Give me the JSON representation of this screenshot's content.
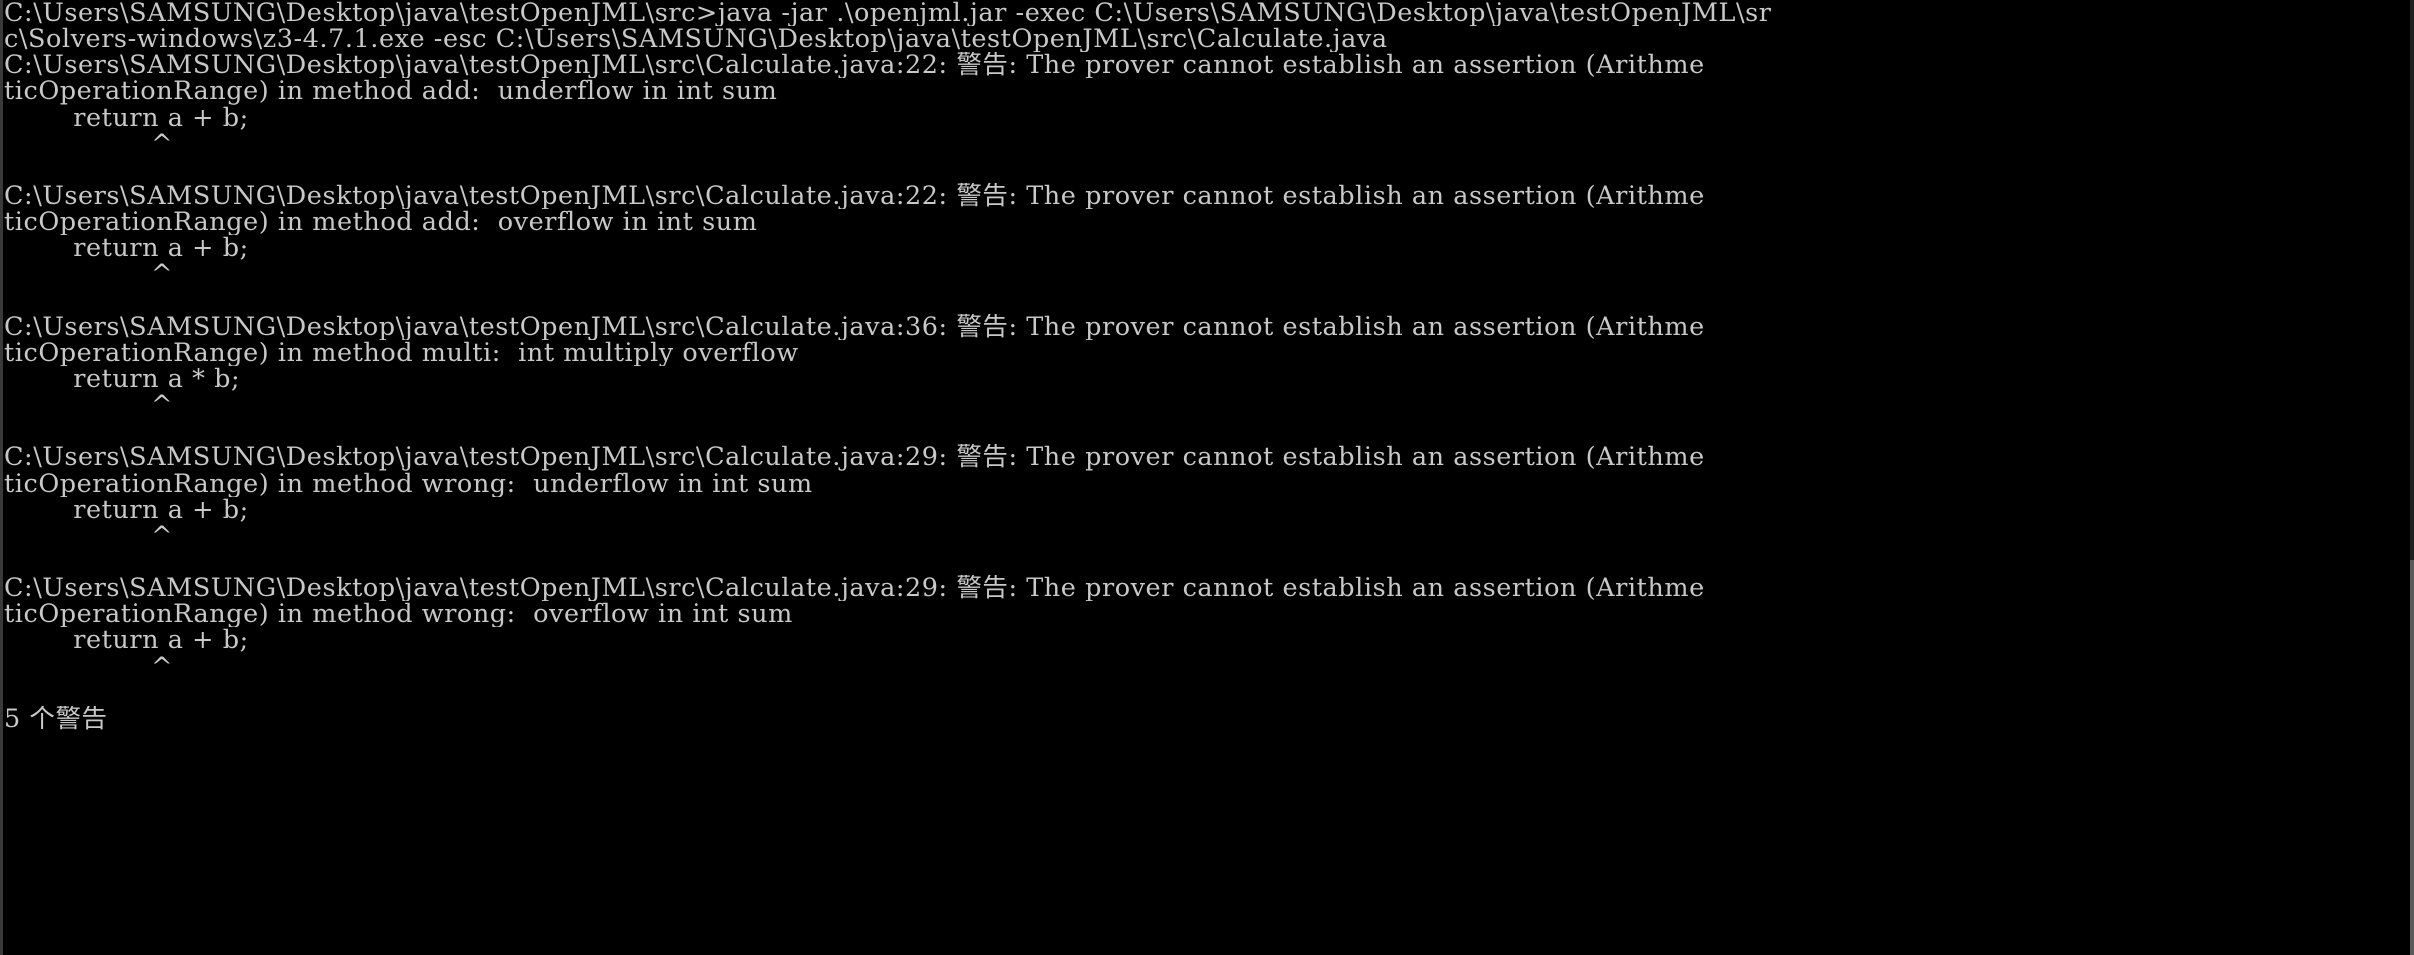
{
  "window": {
    "type": "windows-command-prompt",
    "background_color": "#000000",
    "foreground_color": "#c8c8c8",
    "font_size_px": 25
  },
  "prompt": {
    "path": "C:\\Users\\SAMSUNG\\Desktop\\java\\testOpenJML\\src",
    "symbol": ">",
    "command": "java -jar .\\openjml.jar -exec C:\\Users\\SAMSUNG\\Desktop\\java\\testOpenJML\\src\\Solvers-windows\\z3-4.7.1.exe -esc C:\\Users\\SAMSUNG\\Desktop\\java\\testOpenJML\\src\\Calculate.java"
  },
  "terminal": {
    "lines": [
      "C:\\Users\\SAMSUNG\\Desktop\\java\\testOpenJML\\src>java -jar .\\openjml.jar -exec C:\\Users\\SAMSUNG\\Desktop\\java\\testOpenJML\\sr",
      "c\\Solvers-windows\\z3-4.7.1.exe -esc C:\\Users\\SAMSUNG\\Desktop\\java\\testOpenJML\\src\\Calculate.java",
      "C:\\Users\\SAMSUNG\\Desktop\\java\\testOpenJML\\src\\Calculate.java:22: 警告: The prover cannot establish an assertion (Arithme",
      "ticOperationRange) in method add:  underflow in int sum",
      "        return a + b;",
      "                 ^",
      "",
      "C:\\Users\\SAMSUNG\\Desktop\\java\\testOpenJML\\src\\Calculate.java:22: 警告: The prover cannot establish an assertion (Arithme",
      "ticOperationRange) in method add:  overflow in int sum",
      "        return a + b;",
      "                 ^",
      "",
      "C:\\Users\\SAMSUNG\\Desktop\\java\\testOpenJML\\src\\Calculate.java:36: 警告: The prover cannot establish an assertion (Arithme",
      "ticOperationRange) in method multi:  int multiply overflow",
      "        return a * b;",
      "                 ^",
      "",
      "C:\\Users\\SAMSUNG\\Desktop\\java\\testOpenJML\\src\\Calculate.java:29: 警告: The prover cannot establish an assertion (Arithme",
      "ticOperationRange) in method wrong:  underflow in int sum",
      "        return a + b;",
      "                 ^",
      "",
      "C:\\Users\\SAMSUNG\\Desktop\\java\\testOpenJML\\src\\Calculate.java:29: 警告: The prover cannot establish an assertion (Arithme",
      "ticOperationRange) in method wrong:  overflow in int sum",
      "        return a + b;",
      "                 ^",
      "",
      "5 个警告"
    ],
    "summary": "5 个警告",
    "warning_count": 5,
    "warning_label": "警告",
    "diagnostics": [
      {
        "file": "C:\\Users\\SAMSUNG\\Desktop\\java\\testOpenJML\\src\\Calculate.java",
        "line": 22,
        "severity": "警告",
        "message": "The prover cannot establish an assertion (ArithmeticOperationRange) in method add:  underflow in int sum",
        "code": "        return a + b;",
        "caret_column": 17
      },
      {
        "file": "C:\\Users\\SAMSUNG\\Desktop\\java\\testOpenJML\\src\\Calculate.java",
        "line": 22,
        "severity": "警告",
        "message": "The prover cannot establish an assertion (ArithmeticOperationRange) in method add:  overflow in int sum",
        "code": "        return a + b;",
        "caret_column": 17
      },
      {
        "file": "C:\\Users\\SAMSUNG\\Desktop\\java\\testOpenJML\\src\\Calculate.java",
        "line": 36,
        "severity": "警告",
        "message": "The prover cannot establish an assertion (ArithmeticOperationRange) in method multi:  int multiply overflow",
        "code": "        return a * b;",
        "caret_column": 17
      },
      {
        "file": "C:\\Users\\SAMSUNG\\Desktop\\java\\testOpenJML\\src\\Calculate.java",
        "line": 29,
        "severity": "警告",
        "message": "The prover cannot establish an assertion (ArithmeticOperationRange) in method wrong:  underflow in int sum",
        "code": "        return a + b;",
        "caret_column": 17
      },
      {
        "file": "C:\\Users\\SAMSUNG\\Desktop\\java\\testOpenJML\\src\\Calculate.java",
        "line": 29,
        "severity": "警告",
        "message": "The prover cannot establish an assertion (ArithmeticOperationRange) in method wrong:  overflow in int sum",
        "code": "        return a + b;",
        "caret_column": 17
      }
    ]
  }
}
